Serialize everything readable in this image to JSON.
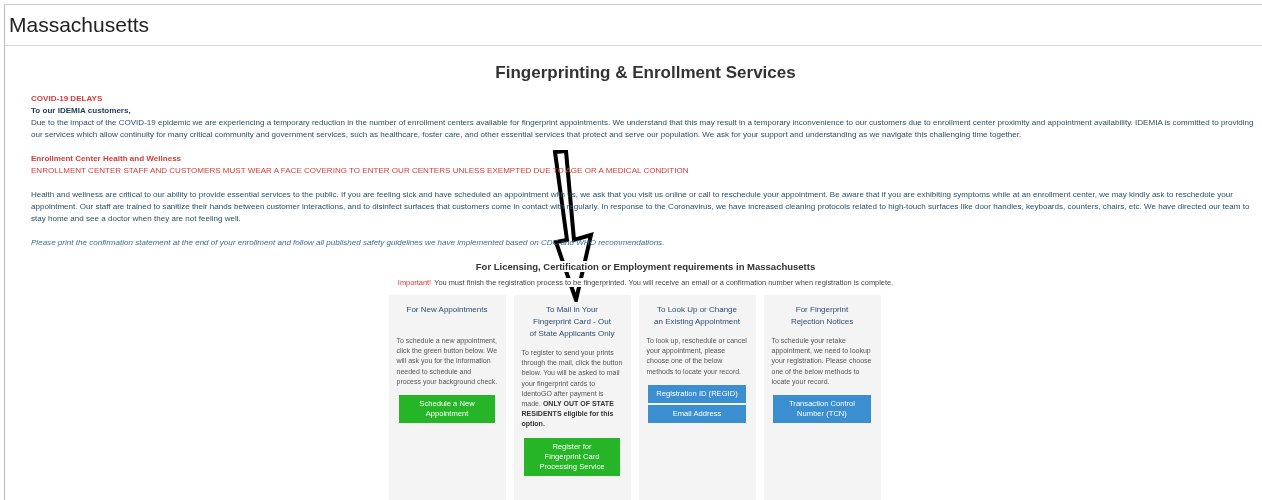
{
  "header": {
    "title": "Massachusetts"
  },
  "page_title": "Fingerprinting & Enrollment Services",
  "notices": [
    {
      "kind": "alert",
      "heading": "COVID-19 DELAYS",
      "subheading": "To our IDEMIA customers,",
      "text": "Due to the impact of the COVID-19 epidemic we are experiencing a temporary reduction in the number of enrollment centers available for fingerprint appointments. We understand that this may result in a temporary inconvenience to our customers due to enrollment center proximity and appointment availability. IDEMIA is committed to providing our services which allow continuity for many critical community and government services, such as healthcare, foster care, and other essential services that protect and serve our population. We ask for your support and understanding as we navigate this challenging time together."
    },
    {
      "kind": "warning",
      "heading": "Enrollment Center Health and Wellness",
      "text": "ENROLLMENT CENTER STAFF AND CUSTOMERS MUST WEAR A FACE COVERING TO ENTER OUR CENTERS UNLESS EXEMPTED DUE TO AGE OR A MEDICAL CONDITION"
    },
    {
      "kind": "plain",
      "text": "Health and wellness are critical to our ability to provide essential services to the public. If you are feeling sick and have scheduled an appointment with us, we ask that you visit us online or call to reschedule your appointment. Be aware that if you are exhibiting symptoms while at an enrollment center, we may kindly ask to reschedule your appointment. Our staff are trained to sanitize their hands between customer interactions, and to disinfect surfaces that customers come in contact with regularly. In response to the Coronavirus, we have increased cleaning protocols related to high-touch surfaces like door handles, keyboards, counters, chairs, etc. We have directed our team to stay home and see a doctor when they are not feeling well."
    },
    {
      "kind": "note",
      "text": "Please print the confirmation statement at the end of your enrollment and follow all published safety guidelines we have implemented based on CDC and WHO recommendations."
    }
  ],
  "requirements": {
    "title": "For Licensing, Certification or Employment requirements in Massachusetts",
    "important_label": "Important!",
    "important_text": "You must finish the registration process to be fingerprinted. You will receive an email or a confirmation number when registration is complete."
  },
  "cards": [
    {
      "title": "For New Appointments",
      "text": "To schedule a new appointment, click the green button below. We will ask you for the information needed to schedule and process your background check.",
      "buttons": [
        {
          "label": "Schedule a New Appointment",
          "kind": "green"
        }
      ]
    },
    {
      "title": "To Mail in Your Fingerprint Card - Out of State Applicants Only",
      "text": "To register to send your prints through the mail, click the button below. You will be asked to mail your fingerprint cards to IdentoGO after payment is made. **ONLY OUT OF STATE RESIDENTS eligible for this option.**",
      "buttons": [
        {
          "label": "Register for Fingerprint Card Processing Service",
          "kind": "green"
        }
      ]
    },
    {
      "title": "To Look Up or Change an Existing Appointment",
      "text": "To look up, reschedule or cancel your appointment, please choose one of the below methods to locate your record.",
      "buttons": [
        {
          "label": "Registration ID (REGID)",
          "kind": "blue"
        },
        {
          "label": "Email Address",
          "kind": "blue"
        }
      ]
    },
    {
      "title": "For Fingerprint Rejection Notices",
      "text": "To schedule your retake appointment, we need to lookup your registration. Please choose one of the below methods to locate your record.",
      "buttons": [
        {
          "label": "Transaction Control Number (TCN)",
          "kind": "blue"
        }
      ]
    }
  ]
}
